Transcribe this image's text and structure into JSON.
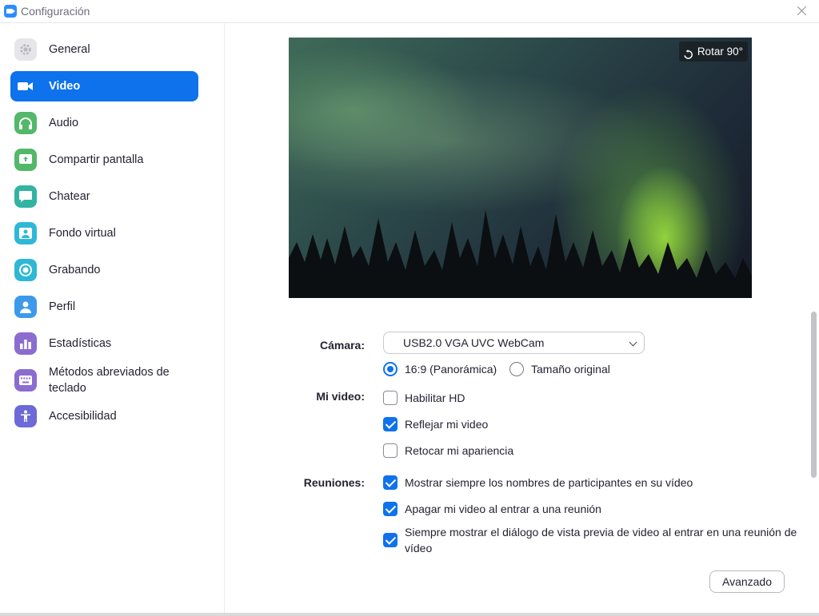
{
  "window": {
    "title": "Configuración"
  },
  "sidebar": {
    "items": [
      {
        "label": "General",
        "icon": "gear-icon",
        "color": "#e6e6ea",
        "active": false
      },
      {
        "label": "Video",
        "icon": "video-camera-icon",
        "color": "#0E72ED",
        "active": true
      },
      {
        "label": "Audio",
        "icon": "headphones-icon",
        "color": "#53b86a",
        "active": false
      },
      {
        "label": "Compartir pantalla",
        "icon": "share-screen-icon",
        "color": "#53b86a",
        "active": false
      },
      {
        "label": "Chatear",
        "icon": "chat-icon",
        "color": "#33b3a2",
        "active": false
      },
      {
        "label": "Fondo virtual",
        "icon": "virtual-background-icon",
        "color": "#2fb8d6",
        "active": false
      },
      {
        "label": "Grabando",
        "icon": "recording-icon",
        "color": "#2fb8d6",
        "active": false
      },
      {
        "label": "Perfil",
        "icon": "profile-icon",
        "color": "#3d9aea",
        "active": false
      },
      {
        "label": "Estadísticas",
        "icon": "statistics-icon",
        "color": "#8b6ccf",
        "active": false
      },
      {
        "label": "Métodos abreviados de teclado",
        "icon": "keyboard-icon",
        "color": "#8b6ccf",
        "active": false
      },
      {
        "label": "Accesibilidad",
        "icon": "accessibility-icon",
        "color": "#6c6ad8",
        "active": false
      }
    ]
  },
  "preview": {
    "rotate_label": "Rotar 90°"
  },
  "camera": {
    "label": "Cámara:",
    "selected": "USB2.0 VGA UVC WebCam",
    "aspect_options": [
      {
        "label": "16:9 (Panorámica)",
        "selected": true
      },
      {
        "label": "Tamaño original",
        "selected": false
      }
    ]
  },
  "my_video": {
    "label": "Mi video:",
    "options": [
      {
        "label": "Habilitar HD",
        "checked": false
      },
      {
        "label": "Reflejar mi video",
        "checked": true
      },
      {
        "label": "Retocar mi apariencia",
        "checked": false
      }
    ]
  },
  "meetings": {
    "label": "Reuniones:",
    "options": [
      {
        "label": "Mostrar siempre los nombres de participantes en su vídeo",
        "checked": true
      },
      {
        "label": "Apagar mi video al entrar a una reunión",
        "checked": true
      },
      {
        "label": "Siempre mostrar el diálogo de vista previa de video al entrar en una reunión de vídeo",
        "checked": true
      }
    ]
  },
  "advanced_button": "Avanzado",
  "colors": {
    "accent": "#0E72ED"
  }
}
